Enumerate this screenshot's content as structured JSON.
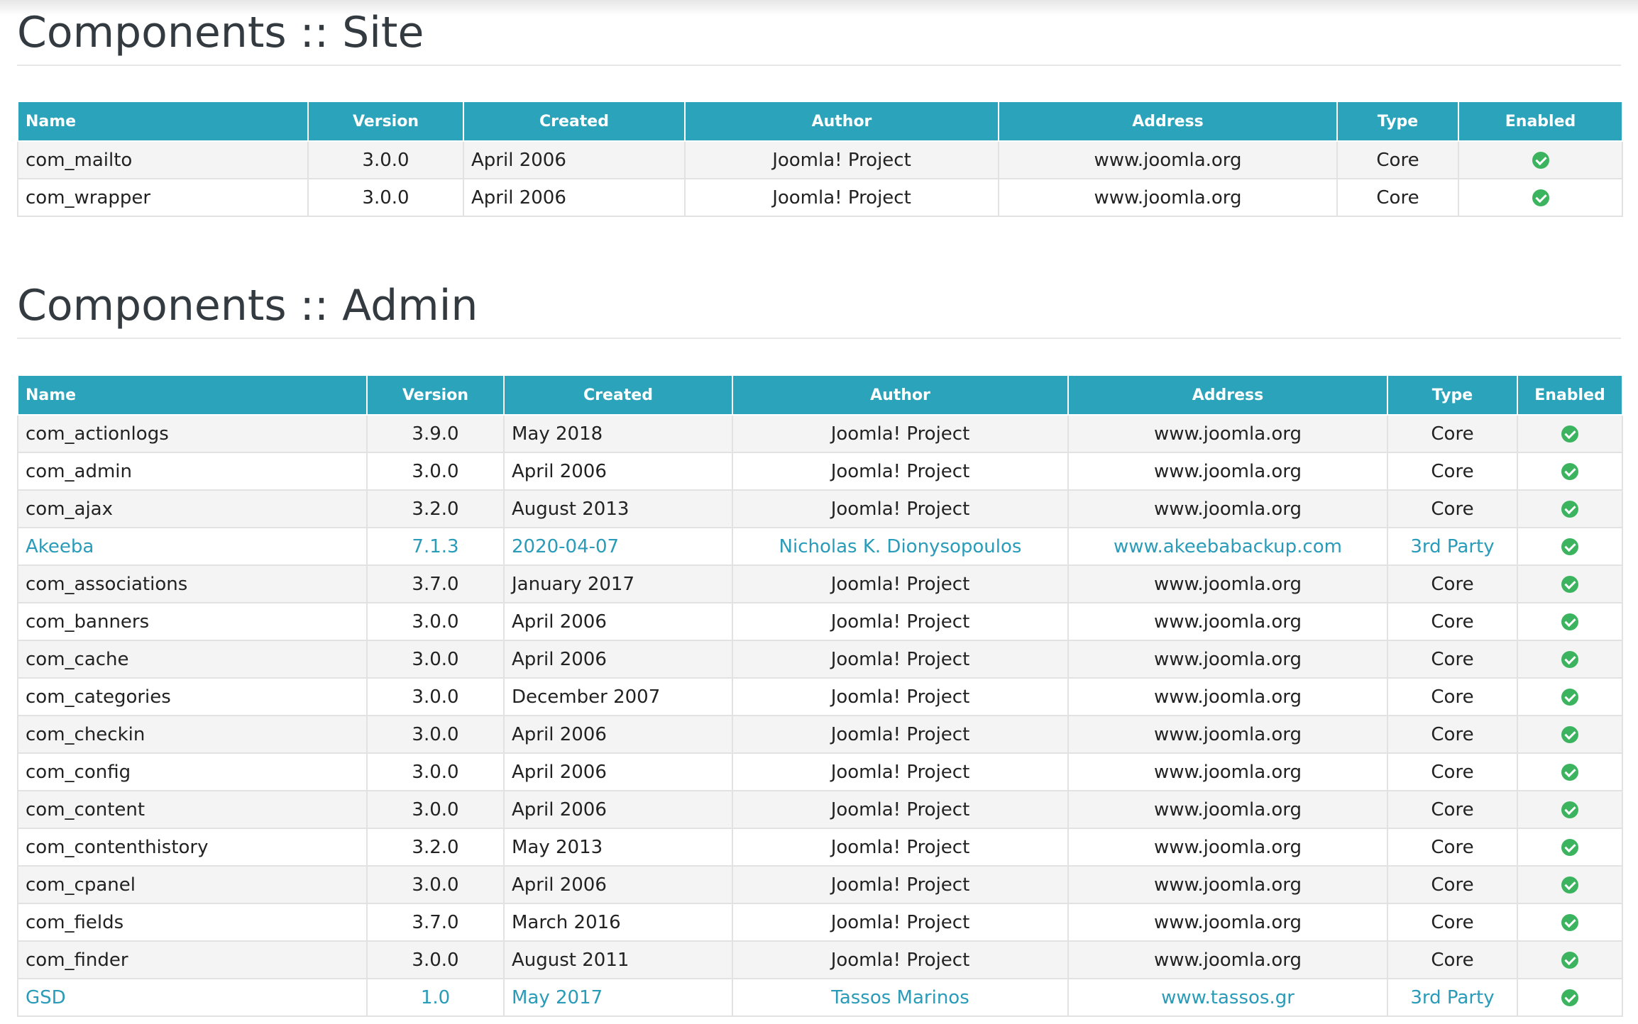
{
  "columns": {
    "name": "Name",
    "version": "Version",
    "created": "Created",
    "author": "Author",
    "address": "Address",
    "type": "Type",
    "enabled": "Enabled"
  },
  "site": {
    "title": "Components :: Site",
    "rows": [
      {
        "name": "com_mailto",
        "version": "3.0.0",
        "created": "April 2006",
        "author": "Joomla! Project",
        "address": "www.joomla.org",
        "type": "Core",
        "enabled": true,
        "third_party": false
      },
      {
        "name": "com_wrapper",
        "version": "3.0.0",
        "created": "April 2006",
        "author": "Joomla! Project",
        "address": "www.joomla.org",
        "type": "Core",
        "enabled": true,
        "third_party": false
      }
    ]
  },
  "admin": {
    "title": "Components :: Admin",
    "rows": [
      {
        "name": "com_actionlogs",
        "version": "3.9.0",
        "created": "May 2018",
        "author": "Joomla! Project",
        "address": "www.joomla.org",
        "type": "Core",
        "enabled": true,
        "third_party": false
      },
      {
        "name": "com_admin",
        "version": "3.0.0",
        "created": "April 2006",
        "author": "Joomla! Project",
        "address": "www.joomla.org",
        "type": "Core",
        "enabled": true,
        "third_party": false
      },
      {
        "name": "com_ajax",
        "version": "3.2.0",
        "created": "August 2013",
        "author": "Joomla! Project",
        "address": "www.joomla.org",
        "type": "Core",
        "enabled": true,
        "third_party": false
      },
      {
        "name": "Akeeba",
        "version": "7.1.3",
        "created": "2020-04-07",
        "author": "Nicholas K. Dionysopoulos",
        "address": "www.akeebabackup.com",
        "type": "3rd Party",
        "enabled": true,
        "third_party": true
      },
      {
        "name": "com_associations",
        "version": "3.7.0",
        "created": "January 2017",
        "author": "Joomla! Project",
        "address": "www.joomla.org",
        "type": "Core",
        "enabled": true,
        "third_party": false
      },
      {
        "name": "com_banners",
        "version": "3.0.0",
        "created": "April 2006",
        "author": "Joomla! Project",
        "address": "www.joomla.org",
        "type": "Core",
        "enabled": true,
        "third_party": false
      },
      {
        "name": "com_cache",
        "version": "3.0.0",
        "created": "April 2006",
        "author": "Joomla! Project",
        "address": "www.joomla.org",
        "type": "Core",
        "enabled": true,
        "third_party": false
      },
      {
        "name": "com_categories",
        "version": "3.0.0",
        "created": "December 2007",
        "author": "Joomla! Project",
        "address": "www.joomla.org",
        "type": "Core",
        "enabled": true,
        "third_party": false
      },
      {
        "name": "com_checkin",
        "version": "3.0.0",
        "created": "April 2006",
        "author": "Joomla! Project",
        "address": "www.joomla.org",
        "type": "Core",
        "enabled": true,
        "third_party": false
      },
      {
        "name": "com_config",
        "version": "3.0.0",
        "created": "April 2006",
        "author": "Joomla! Project",
        "address": "www.joomla.org",
        "type": "Core",
        "enabled": true,
        "third_party": false
      },
      {
        "name": "com_content",
        "version": "3.0.0",
        "created": "April 2006",
        "author": "Joomla! Project",
        "address": "www.joomla.org",
        "type": "Core",
        "enabled": true,
        "third_party": false
      },
      {
        "name": "com_contenthistory",
        "version": "3.2.0",
        "created": "May 2013",
        "author": "Joomla! Project",
        "address": "www.joomla.org",
        "type": "Core",
        "enabled": true,
        "third_party": false
      },
      {
        "name": "com_cpanel",
        "version": "3.0.0",
        "created": "April 2006",
        "author": "Joomla! Project",
        "address": "www.joomla.org",
        "type": "Core",
        "enabled": true,
        "third_party": false
      },
      {
        "name": "com_fields",
        "version": "3.7.0",
        "created": "March 2016",
        "author": "Joomla! Project",
        "address": "www.joomla.org",
        "type": "Core",
        "enabled": true,
        "third_party": false
      },
      {
        "name": "com_finder",
        "version": "3.0.0",
        "created": "August 2011",
        "author": "Joomla! Project",
        "address": "www.joomla.org",
        "type": "Core",
        "enabled": true,
        "third_party": false
      },
      {
        "name": "GSD",
        "version": "1.0",
        "created": "May 2017",
        "author": "Tassos Marinos",
        "address": "www.tassos.gr",
        "type": "3rd Party",
        "enabled": true,
        "third_party": true
      }
    ]
  },
  "colors": {
    "header_bg": "#2aa3bb",
    "third_party_text": "#2a9bb8",
    "enabled_icon": "#3cb45f"
  },
  "icons": {
    "enabled": "check-circle-icon"
  }
}
